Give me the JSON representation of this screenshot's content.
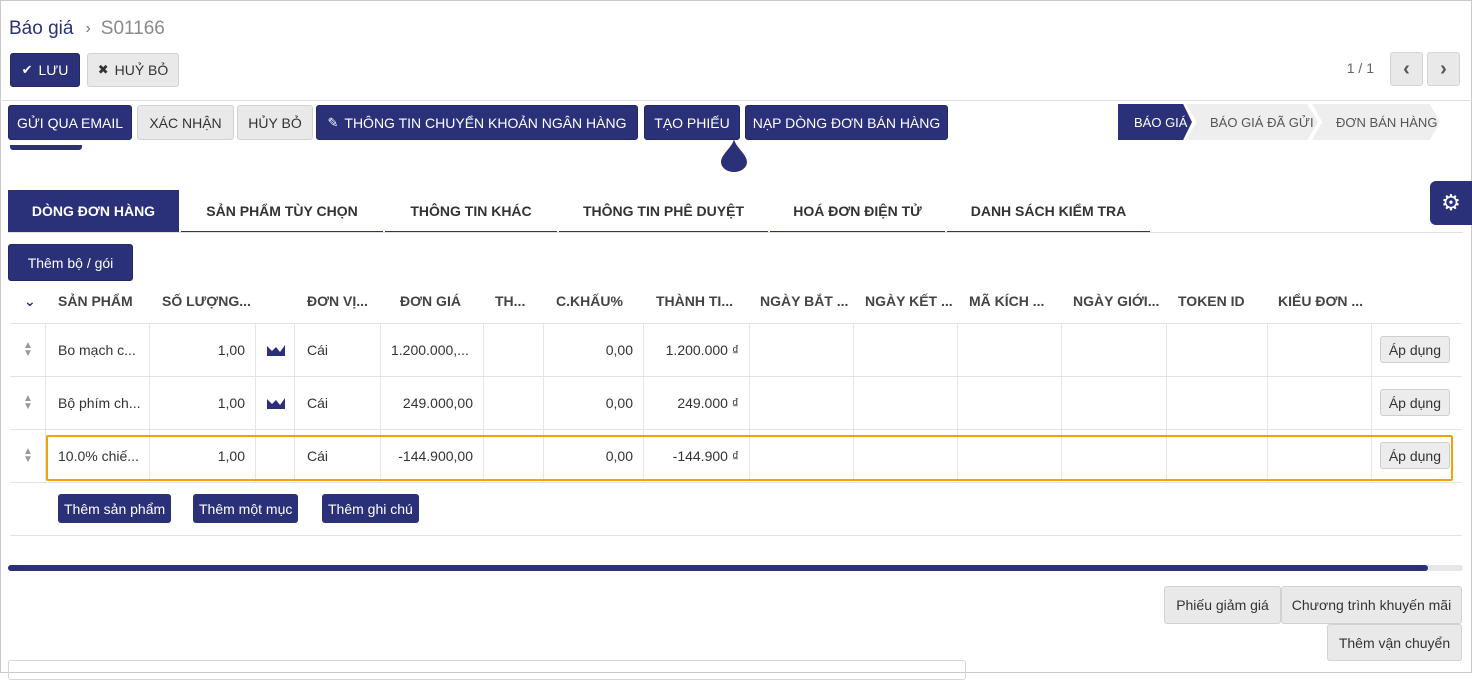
{
  "breadcrumb": {
    "parent": "Báo giá",
    "separator": "›",
    "current": "S01166"
  },
  "toolbar": {
    "save_label": "LƯU",
    "discard_label": "HUỶ BỎ"
  },
  "pager": {
    "value": "1 / 1",
    "prev_icon": "chevron-left-icon",
    "next_icon": "chevron-right-icon"
  },
  "actions": {
    "send_email": "GỬI QUA EMAIL",
    "confirm": "XÁC NHẬN",
    "cancel": "HỦY BỎ",
    "bank_info": "THÔNG TIN CHUYỂN KHOẢN NGÂN HÀNG",
    "create_ticket": "TẠO PHIẾU",
    "load_lines": "NẠP DÒNG ĐƠN BÁN HÀNG"
  },
  "status_bar": {
    "states": [
      "BÁO GIÁ",
      "BÁO GIÁ ĐÃ GỬI",
      "ĐƠN BÁN HÀNG"
    ],
    "active_index": 0
  },
  "tabs": [
    "DÒNG ĐƠN HÀNG",
    "SẢN PHẨM TÙY CHỌN",
    "THÔNG TIN KHÁC",
    "THÔNG TIN PHÊ DUYỆT",
    "HOÁ ĐƠN ĐIỆN TỬ",
    "DANH SÁCH KIỂM TRA"
  ],
  "add_bundle_label": "Thêm bộ / gói",
  "table": {
    "headers": [
      "SẢN PHẨM",
      "SỐ LƯỢNG...",
      "ĐƠN VỊ...",
      "ĐƠN GIÁ",
      "TH...",
      "C.KHẤU%",
      "THÀNH TI...",
      "NGÀY BẮT ...",
      "NGÀY KẾT ...",
      "MÃ KÍCH ...",
      "NGÀY GIỚI...",
      "TOKEN ID",
      "KIỂU ĐƠN ..."
    ],
    "rows": [
      {
        "product": "Bo mạch c...",
        "qty": "1,00",
        "uom": "Cái",
        "price": "1.200.000,...",
        "discount": "0,00",
        "subtotal": "1.200.000 ₫",
        "has_chart": true,
        "apply": "Áp dụng"
      },
      {
        "product": "Bộ phím ch...",
        "qty": "1,00",
        "uom": "Cái",
        "price": "249.000,00",
        "discount": "0,00",
        "subtotal": "249.000 ₫",
        "has_chart": true,
        "apply": "Áp dụng"
      },
      {
        "product": "10.0% chiế...",
        "qty": "1,00",
        "uom": "Cái",
        "price": "-144.900,00",
        "discount": "0,00",
        "subtotal": "-144.900 ₫",
        "has_chart": false,
        "apply": "Áp dụng"
      }
    ],
    "add_product": "Thêm sản phẩm",
    "add_section": "Thêm một mục",
    "add_note": "Thêm ghi chú"
  },
  "footer": {
    "coupon": "Phiếu giảm giá",
    "promotion": "Chương trình khuyến mãi",
    "add_shipping": "Thêm vận chuyển"
  },
  "colors": {
    "primary": "#2b3178",
    "highlight": "#f0a30a"
  }
}
